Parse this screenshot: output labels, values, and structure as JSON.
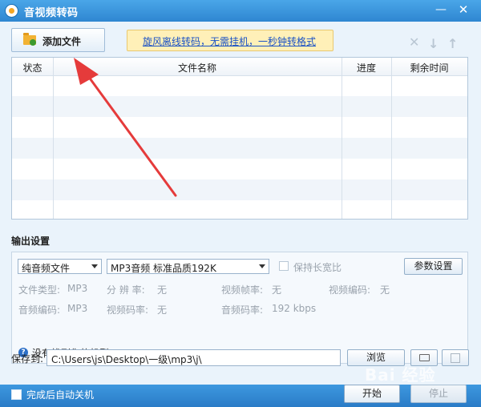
{
  "window": {
    "title": "音视频转码"
  },
  "toolbar": {
    "add_file_label": "添加文件",
    "promo_text": "旋风离线转码，无需挂机，一秒钟转格式"
  },
  "table": {
    "columns": [
      "状态",
      "文件名称",
      "进度",
      "剩余时间"
    ]
  },
  "output": {
    "section_title": "输出设置",
    "format_select": "纯音频文件",
    "preset_select": "MP3音频 标准品质192K",
    "keep_ratio_label": "保持长宽比",
    "params_button": "参数设置",
    "info": {
      "file_type_label": "文件类型:",
      "file_type_value": "MP3",
      "resolution_label": "分 辨 率:",
      "resolution_value": "无",
      "video_fps_label": "视频帧率:",
      "video_fps_value": "无",
      "video_codec_label": "视频编码:",
      "video_codec_value": "无",
      "audio_codec_label": "音频编码:",
      "audio_codec_value": "MP3",
      "video_bitrate_label": "视频码率:",
      "video_bitrate_value": "无",
      "audio_bitrate_label": "音频码率:",
      "audio_bitrate_value": "192 kbps"
    },
    "help_text": "没有找到您的机型?"
  },
  "save": {
    "label": "保存到:",
    "path": "C:\\Users\\js\\Desktop\\一级\\mp3\\j\\",
    "browse_button": "浏览"
  },
  "bottom": {
    "shutdown_label": "完成后自动关机",
    "start_button": "开始",
    "stop_button": "停止"
  },
  "watermark": "Bai 经验",
  "colors": {
    "title_bar": "#2f86d1",
    "arrow": "#e53b3b",
    "promo_bg": "#fff0b8",
    "link": "#1a52c5"
  }
}
